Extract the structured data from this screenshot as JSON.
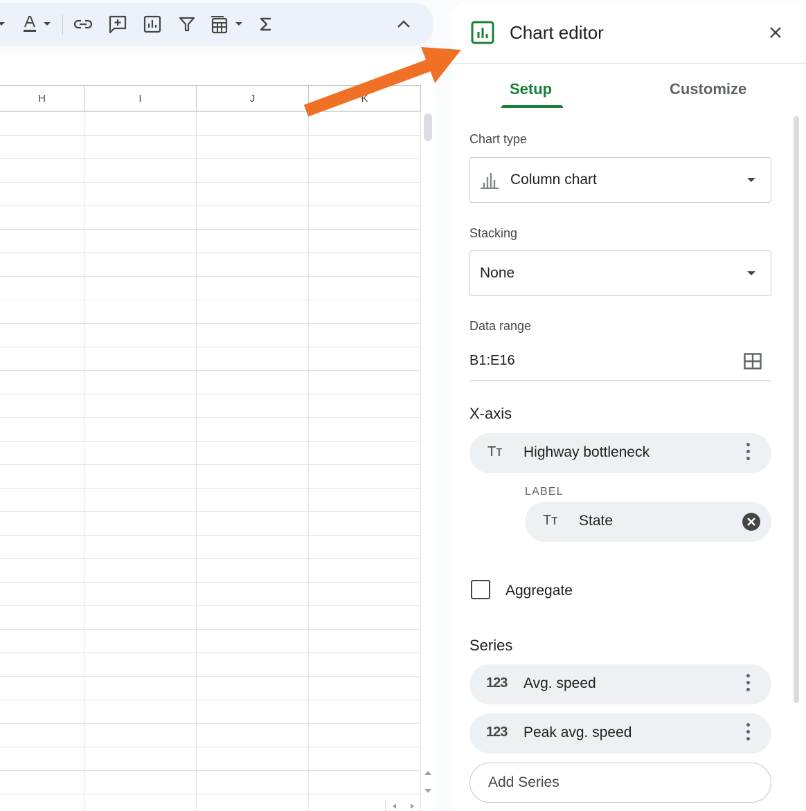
{
  "toolbar": {
    "collapse_icon": "chevron-up-icon",
    "icons": [
      "dropdown-caret-icon",
      "text-color-icon",
      "link-icon",
      "comment-icon",
      "chart-icon",
      "filter-icon",
      "table-view-icon",
      "functions-icon"
    ]
  },
  "sheet": {
    "columns": [
      "H",
      "I",
      "J",
      "K"
    ]
  },
  "annotation": {
    "color": "#f07026"
  },
  "chart_editor": {
    "title": "Chart editor",
    "accent": "#188038",
    "tabs": [
      "Setup",
      "Customize"
    ],
    "active_tab": "Setup",
    "chart_type": {
      "label": "Chart type",
      "value": "Column chart"
    },
    "stacking": {
      "label": "Stacking",
      "value": "None"
    },
    "data_range": {
      "label": "Data range",
      "value": "B1:E16"
    },
    "x_axis": {
      "heading": "X-axis",
      "field": "Highway bottleneck",
      "sublabel": "LABEL",
      "label_field": "State",
      "text_icon": "Tт"
    },
    "aggregate": {
      "label": "Aggregate",
      "checked": false
    },
    "series": {
      "heading": "Series",
      "number_icon": "123",
      "items": [
        "Avg. speed",
        "Peak avg. speed"
      ],
      "add_label": "Add Series"
    }
  }
}
